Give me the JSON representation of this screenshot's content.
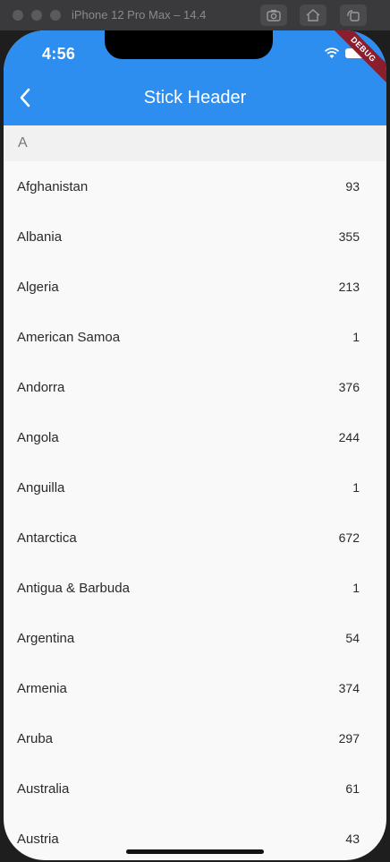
{
  "simulator": {
    "title": "iPhone 12 Pro Max – 14.4"
  },
  "status_bar": {
    "time": "4:56",
    "debug_label": "DEBUG"
  },
  "app_bar": {
    "title": "Stick Header",
    "back_icon": "chevron-left-icon",
    "color": "#2e8ef0"
  },
  "section": {
    "header": "A"
  },
  "rows": [
    {
      "name": "Afghanistan",
      "count": "93"
    },
    {
      "name": "Albania",
      "count": "355"
    },
    {
      "name": "Algeria",
      "count": "213"
    },
    {
      "name": "American Samoa",
      "count": "1"
    },
    {
      "name": "Andorra",
      "count": "376"
    },
    {
      "name": "Angola",
      "count": "244"
    },
    {
      "name": "Anguilla",
      "count": "1"
    },
    {
      "name": "Antarctica",
      "count": "672"
    },
    {
      "name": "Antigua & Barbuda",
      "count": "1"
    },
    {
      "name": "Argentina",
      "count": "54"
    },
    {
      "name": "Armenia",
      "count": "374"
    },
    {
      "name": "Aruba",
      "count": "297"
    },
    {
      "name": "Australia",
      "count": "61"
    },
    {
      "name": "Austria",
      "count": "43"
    }
  ]
}
